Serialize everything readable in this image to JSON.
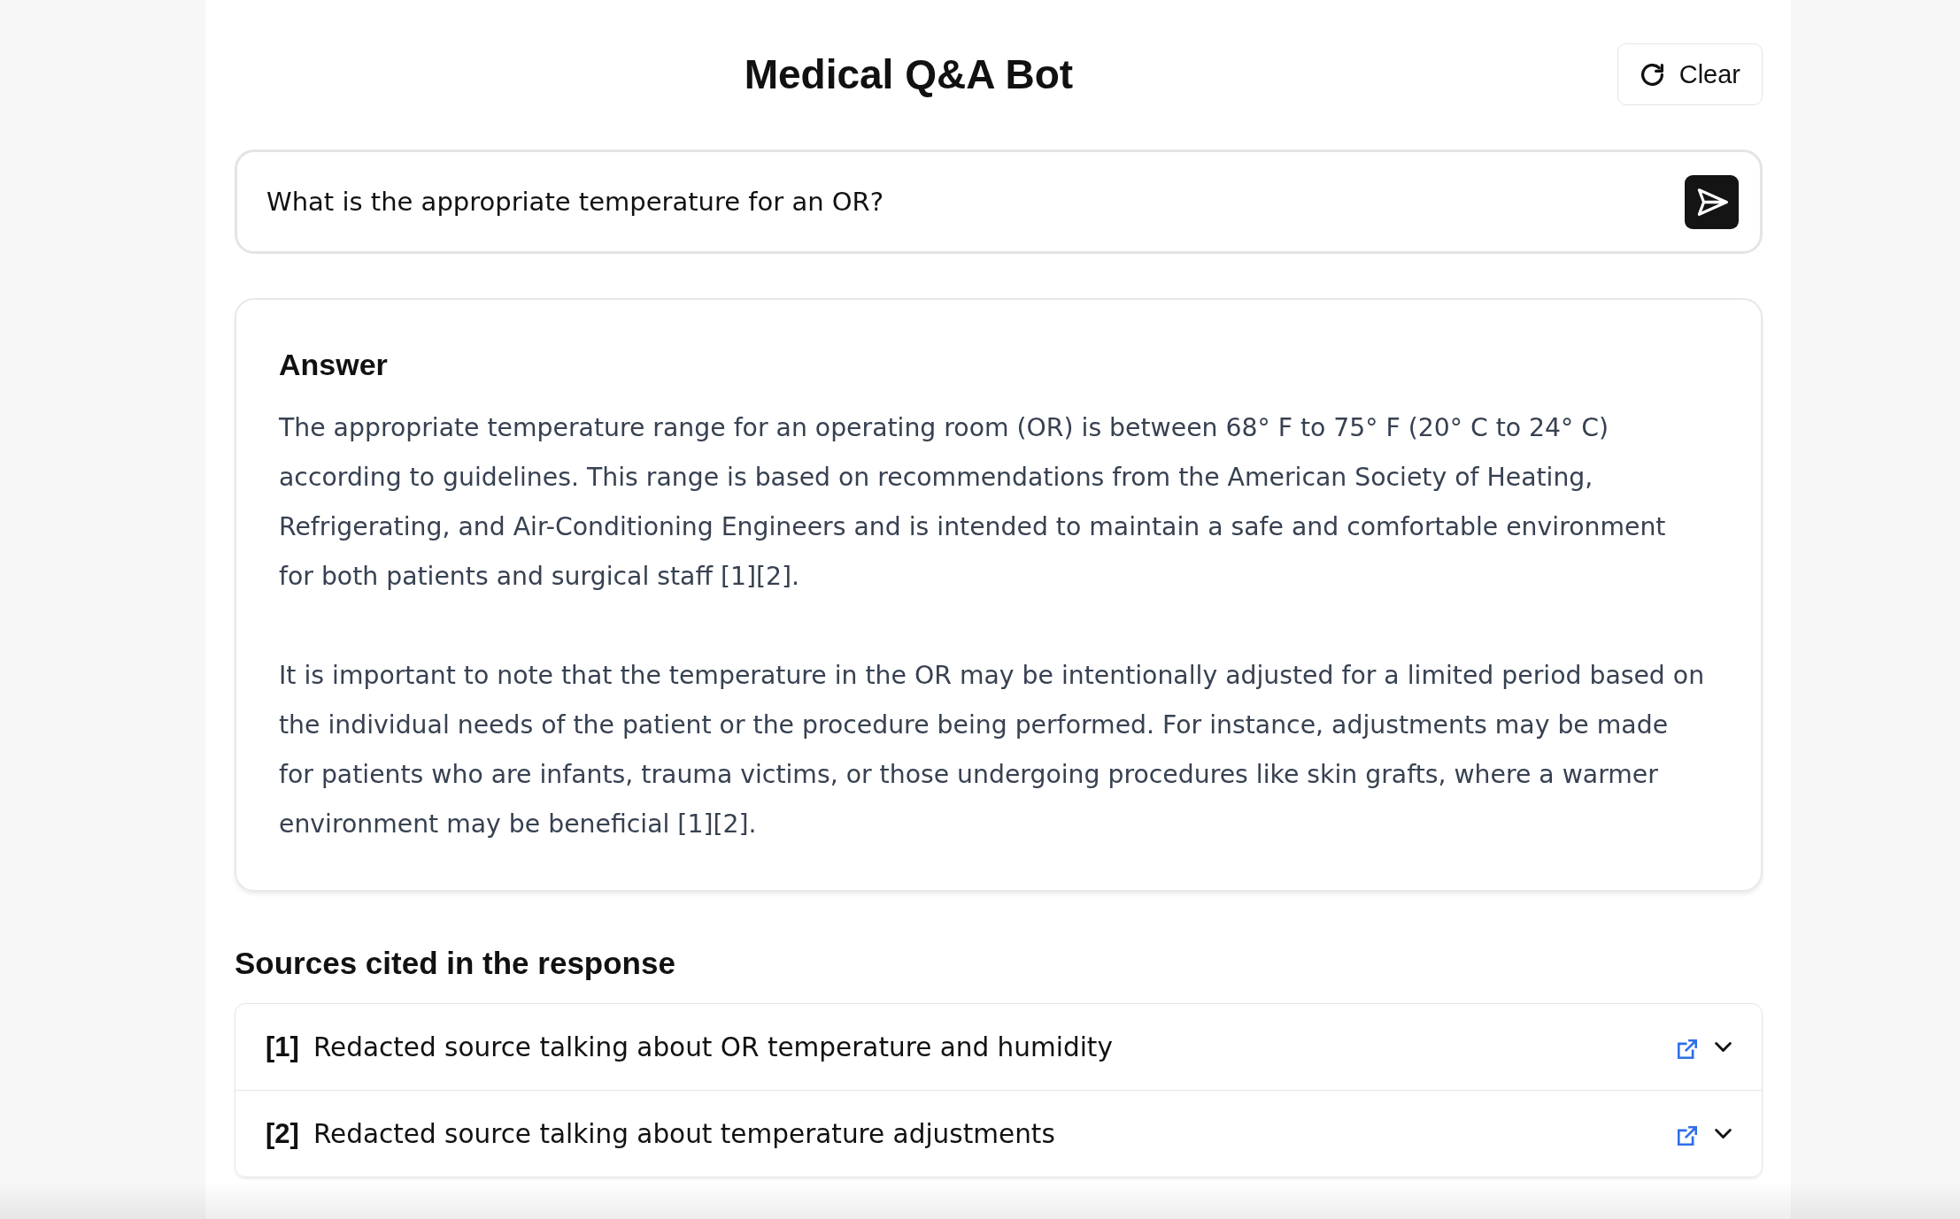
{
  "header": {
    "title": "Medical Q&A Bot",
    "clear_button": {
      "label": "Clear"
    }
  },
  "question": {
    "value": "What is the appropriate temperature for an OR?"
  },
  "answer": {
    "heading": "Answer",
    "paragraphs": [
      "The appropriate temperature range for an operating room (OR) is between 68° F to 75° F (20° C to 24° C) according to guidelines. This range is based on recommendations from the American Society of Heating, Refrigerating, and Air-Conditioning Engineers and is intended to maintain a safe and comfortable environment for both patients and surgical staff [1][2].",
      "It is important to note that the temperature in the OR may be intentionally adjusted for a limited period based on the individual needs of the patient or the procedure being performed. For instance, adjustments may be made for patients who are infants, trauma victims, or those undergoing procedures like skin grafts, where a warmer environment may be beneficial [1][2]."
    ]
  },
  "sources": {
    "heading": "Sources cited in the response",
    "items": [
      {
        "index": "[1]",
        "title": "Redacted source talking about OR temperature and humidity",
        "expanded": false
      },
      {
        "index": "[2]",
        "title": "Redacted source talking about temperature adjustments",
        "expanded": false
      }
    ]
  }
}
